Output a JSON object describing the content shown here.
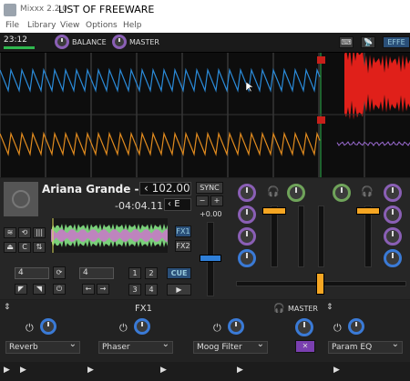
{
  "window": {
    "app": "Mixxx 2.2.0",
    "title": "LIST OF FREEWARE"
  },
  "menu": [
    "File",
    "Library",
    "View",
    "Options",
    "Help"
  ],
  "topbar": {
    "clock": "23:12",
    "balance_label": "BALANCE",
    "master_label": "MASTER",
    "effects_label": "EFFE"
  },
  "deck": {
    "title": "Ariana Grande -...",
    "bpm": "102.00",
    "time": "-04:04.11",
    "key": "E",
    "sync_label": "SYNC",
    "minus": "−",
    "plus": "+",
    "rate": "+0.00",
    "fx1": "FX1",
    "fx2": "FX2",
    "loop_size": "4",
    "beatjump_size": "4",
    "hotcues": [
      "1",
      "2",
      "3",
      "4"
    ],
    "cue_label": "CUE",
    "play_glyph": "▶",
    "icons": [
      "waveform-icon",
      "repeat-icon",
      "bars-icon",
      "eject-icon",
      "cue-loop-icon",
      "loop-icon"
    ]
  },
  "fx": {
    "unit_label": "FX1",
    "master_label": "MASTER",
    "effects": [
      "Reverb",
      "Phaser",
      "Moog Filter"
    ],
    "eq": "Param EQ"
  },
  "colors": {
    "deck1_wave": "#2a8ad8",
    "deck2_wave": "#e08a1e",
    "red_wave": "#e0201a",
    "accent_orange": "#f5a623",
    "playhead": "#2fb84f"
  }
}
